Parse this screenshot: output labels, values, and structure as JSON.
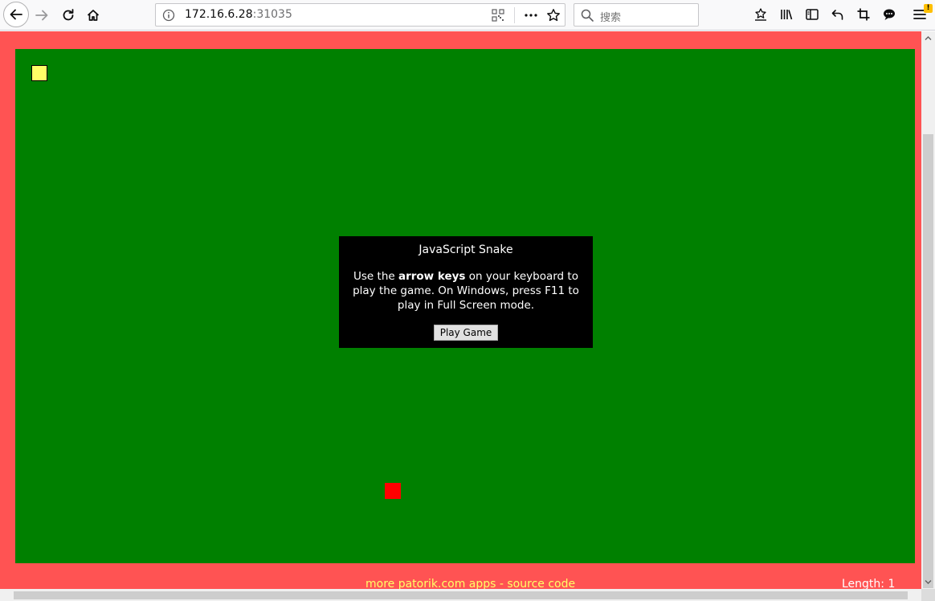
{
  "browser": {
    "url_host": "172.16.6.28",
    "url_port": ":31035",
    "search_placeholder": "搜索",
    "alert_badge": "!",
    "icons": {
      "back": "back-arrow-icon",
      "forward": "forward-arrow-icon",
      "reload": "reload-icon",
      "home": "home-icon",
      "info": "info-icon",
      "qr": "qr-code-icon",
      "page_actions": "more-dots-icon",
      "bookmark": "star-icon",
      "search": "search-icon",
      "pocket": "pocket-icon",
      "library": "library-icon",
      "sidebar": "sidebar-icon",
      "undo": "undo-icon",
      "screenshot": "crop-icon",
      "chat": "chat-bubble-icon",
      "menu": "hamburger-menu-icon"
    }
  },
  "game": {
    "board_color": "#008000",
    "page_bg_color": "#ff5353",
    "snake_color": "#ffff66",
    "food_color": "#ff0000",
    "dialog": {
      "title": "JavaScript Snake",
      "body_prefix": "Use the ",
      "body_bold": "arrow keys",
      "body_suffix": " on your keyboard to play the game. On Windows, press F11 to play in Full Screen mode.",
      "play_button": "Play Game"
    },
    "footer": {
      "apps_link": "more patorik.com apps",
      "separator": " - ",
      "source_link": "source code"
    },
    "length_label": "Length: 1"
  }
}
